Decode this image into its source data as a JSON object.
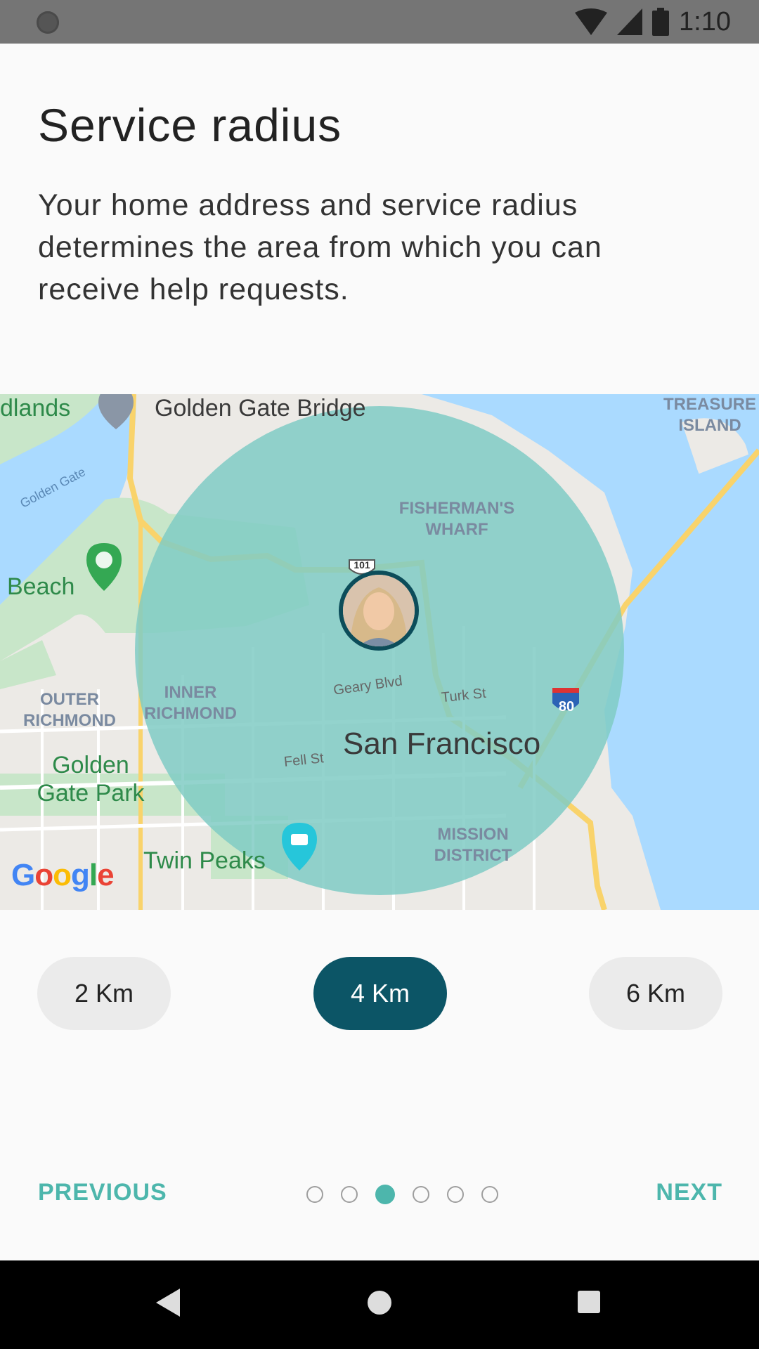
{
  "status_bar": {
    "time": "1:10"
  },
  "header": {
    "title": "Service radius",
    "description": "Your home address and service radius determines the area from which you can receive help requests."
  },
  "map": {
    "labels": {
      "golden_gate_bridge": "Golden Gate Bridge",
      "treasure_island": "TREASURE ISLAND",
      "highlands": "dlands",
      "golden_gate_water": "Golden Gate",
      "fishermans_wharf": "FISHERMAN'S WHARF",
      "beach": "Beach",
      "outer_richmond": "OUTER RICHMOND",
      "inner_richmond": "INNER RICHMOND",
      "geary": "Geary Blvd",
      "turk": "Turk St",
      "san_francisco": "San Francisco",
      "fell": "Fell St",
      "golden_gate_park": "Golden Gate Park",
      "twin_peaks": "Twin Peaks",
      "mission_district": "MISSION DISTRICT",
      "interstate": "80",
      "highway": "101"
    },
    "attribution": "Google",
    "radius_color": "#80cbc4"
  },
  "radius_options": [
    {
      "label": "2 Km",
      "selected": false
    },
    {
      "label": "4 Km",
      "selected": true
    },
    {
      "label": "6 Km",
      "selected": false
    }
  ],
  "navigation": {
    "previous": "PREVIOUS",
    "next": "NEXT",
    "page_count": 6,
    "current_page": 3
  },
  "colors": {
    "accent": "#4db6ac",
    "selected_button": "#0c5566",
    "avatar_border": "#0c4d5a"
  }
}
